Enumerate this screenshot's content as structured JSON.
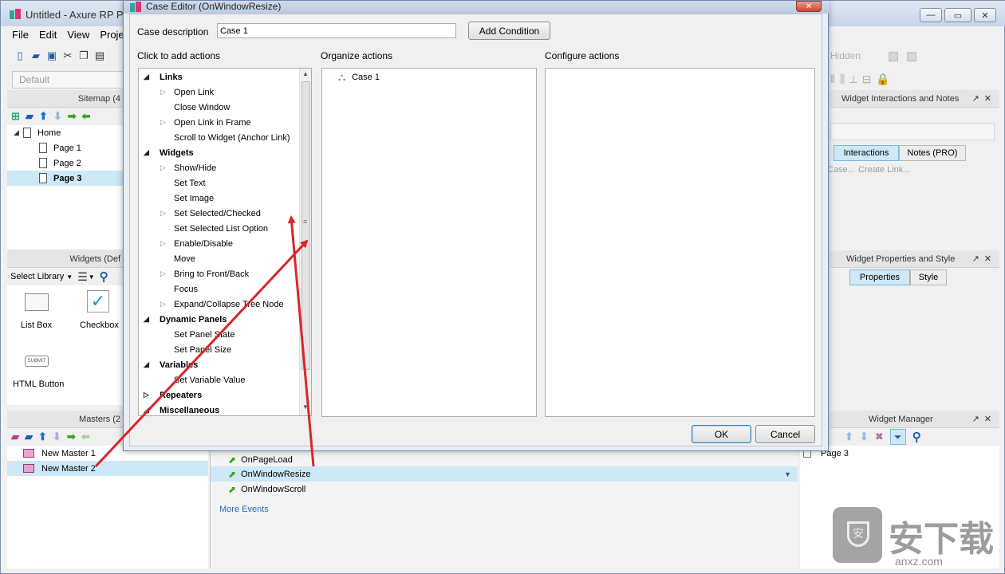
{
  "app": {
    "title": "Untitled - Axure RP Pr",
    "menus": [
      "File",
      "Edit",
      "View",
      "Projec"
    ],
    "style_select": "Default"
  },
  "sitemap": {
    "header": "Sitemap (4",
    "items": [
      {
        "label": "Home"
      },
      {
        "label": "Page 1"
      },
      {
        "label": "Page 2"
      },
      {
        "label": "Page 3"
      }
    ]
  },
  "widgets": {
    "header": "Widgets (Def",
    "select_library": "Select Library",
    "items": [
      {
        "label": "List Box"
      },
      {
        "label": "Checkbox"
      },
      {
        "label": "HTML Button"
      }
    ],
    "submit_glyph": "SUBMIT"
  },
  "masters": {
    "header": "Masters (2",
    "items": [
      {
        "label": "New Master 1"
      },
      {
        "label": "New Master 2"
      }
    ]
  },
  "page_events": {
    "items": [
      {
        "label": "OnPageLoad"
      },
      {
        "label": "OnWindowResize"
      },
      {
        "label": "OnWindowScroll"
      }
    ],
    "more_events": "More Events"
  },
  "right_panels": {
    "toolbar_hidden": "Hidden",
    "interactions_header": "Widget Interactions and Notes",
    "tab_interactions": "Interactions",
    "tab_notes": "Notes (PRO)",
    "case_link": "Case...",
    "create_link": "Create Link...",
    "properties_header": "Widget Properties and Style",
    "tab_properties": "Properties",
    "tab_style": "Style",
    "manager_header": "Widget Manager",
    "manager_item": "Page 3"
  },
  "dialog": {
    "title": "Case Editor (OnWindowResize)",
    "case_description_label": "Case description",
    "case_description_value": "Case 1",
    "add_condition": "Add Condition",
    "col1_label": "Click to add actions",
    "col2_label": "Organize actions",
    "col3_label": "Configure actions",
    "case_node": "Case 1",
    "ok": "OK",
    "cancel": "Cancel",
    "actions": [
      {
        "label": "Links",
        "cat": true
      },
      {
        "label": "Open Link",
        "exp": true
      },
      {
        "label": "Close Window"
      },
      {
        "label": "Open Link in Frame",
        "exp": true
      },
      {
        "label": "Scroll to Widget (Anchor Link)"
      },
      {
        "label": "Widgets",
        "cat": true
      },
      {
        "label": "Show/Hide",
        "exp": true
      },
      {
        "label": "Set Text"
      },
      {
        "label": "Set Image"
      },
      {
        "label": "Set Selected/Checked",
        "exp": true
      },
      {
        "label": "Set Selected List Option"
      },
      {
        "label": "Enable/Disable",
        "exp": true
      },
      {
        "label": "Move"
      },
      {
        "label": "Bring to Front/Back",
        "exp": true
      },
      {
        "label": "Focus"
      },
      {
        "label": "Expand/Collapse Tree Node",
        "exp": true
      },
      {
        "label": "Dynamic Panels",
        "cat": true
      },
      {
        "label": "Set Panel State"
      },
      {
        "label": "Set Panel Size"
      },
      {
        "label": "Variables",
        "cat": true
      },
      {
        "label": "Set Variable Value"
      },
      {
        "label": "Repeaters",
        "cat": true,
        "collapsed": true
      },
      {
        "label": "Miscellaneous",
        "cat": true
      }
    ]
  },
  "watermark": {
    "text": "安下载",
    "sub": "anxz.com"
  },
  "colors": {
    "arrow": "#d8262b",
    "selection": "#cde8f6",
    "accent": "#1d5fa8"
  }
}
